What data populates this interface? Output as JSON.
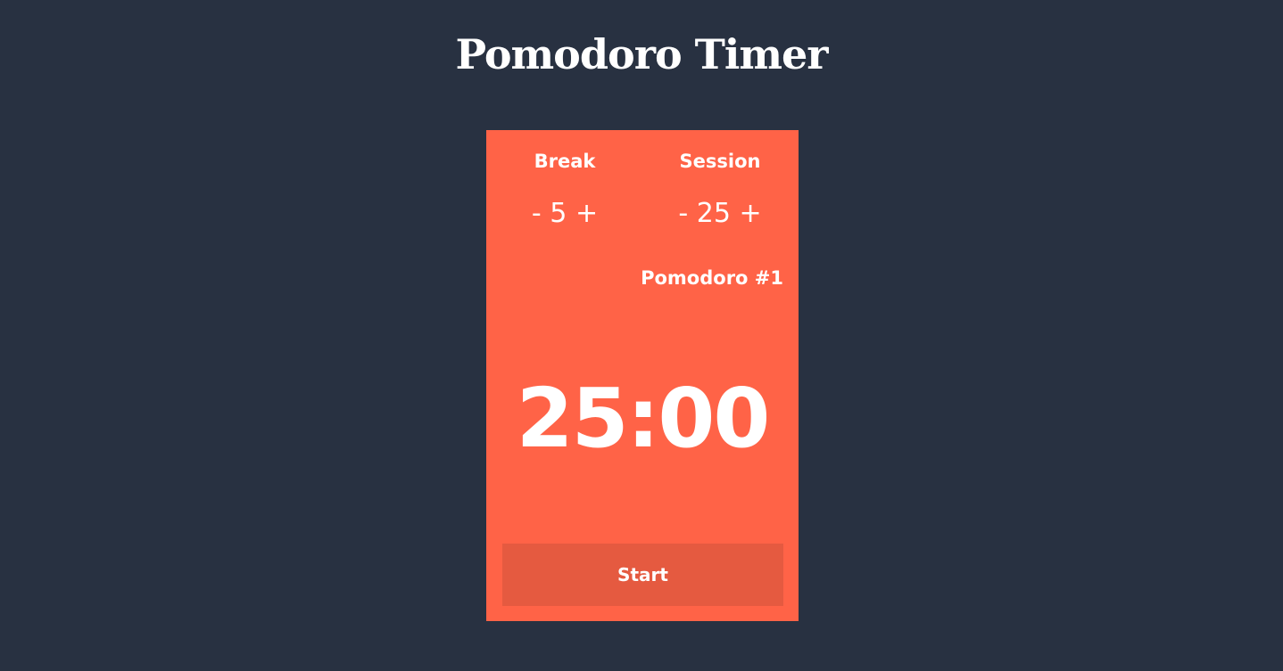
{
  "title": "Pomodoro Timer",
  "break": {
    "label": "Break",
    "decrement": "-",
    "value": "5",
    "increment": "+"
  },
  "session": {
    "label": "Session",
    "decrement": "-",
    "value": "25",
    "increment": "+"
  },
  "counter": "Pomodoro #1",
  "timer": "25:00",
  "start_label": "Start",
  "colors": {
    "background": "#283141",
    "card": "#ff6347",
    "button": "#e55a40"
  }
}
